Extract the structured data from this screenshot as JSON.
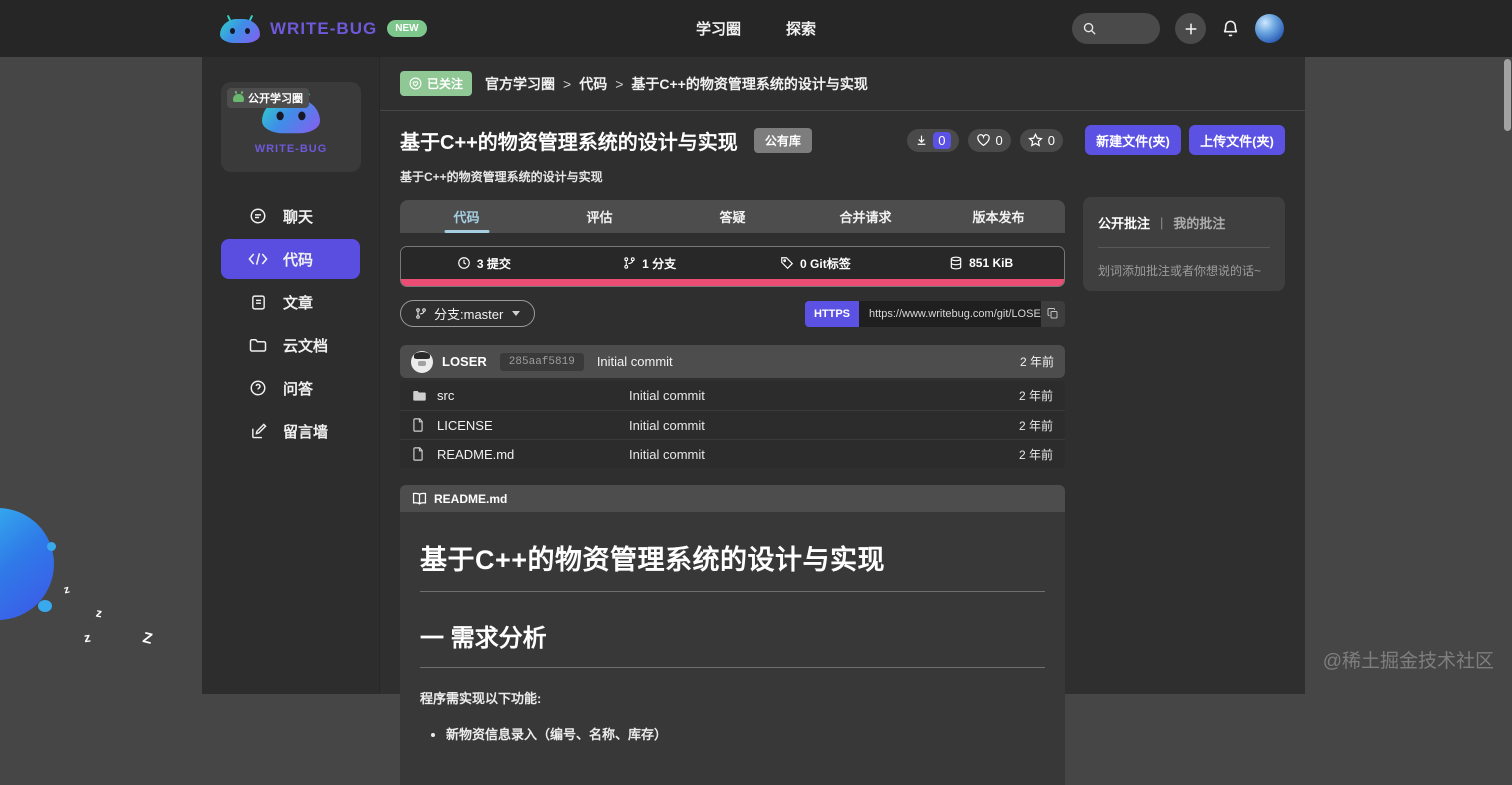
{
  "header": {
    "logo_text": "WRITE-BUG",
    "new_badge": "NEW",
    "nav": [
      {
        "label": "学习圈"
      },
      {
        "label": "探索"
      }
    ]
  },
  "sidebar": {
    "circle_badge": "公开学习圈",
    "circle_logo_text": "WRITE-BUG",
    "items": [
      {
        "label": "聊天",
        "icon": "chat",
        "active": false
      },
      {
        "label": "代码",
        "icon": "code",
        "active": true
      },
      {
        "label": "文章",
        "icon": "article",
        "active": false
      },
      {
        "label": "云文档",
        "icon": "cloud-doc",
        "active": false
      },
      {
        "label": "问答",
        "icon": "qa",
        "active": false
      },
      {
        "label": "留言墙",
        "icon": "message-wall",
        "active": false
      }
    ]
  },
  "breadcrumb": {
    "follow_label": "已关注",
    "items": [
      "官方学习圈",
      "代码",
      "基于C++的物资管理系统的设计与实现"
    ],
    "separator": ">"
  },
  "repo": {
    "title": "基于C++的物资管理系统的设计与实现",
    "visibility_badge": "公有库",
    "subtitle": "基于C++的物资管理系统的设计与实现",
    "downloads": "0",
    "likes": "0",
    "stars": "0",
    "new_file_button": "新建文件(夹)",
    "upload_file_button": "上传文件(夹)"
  },
  "tabs": [
    {
      "label": "代码",
      "active": true
    },
    {
      "label": "评估",
      "active": false
    },
    {
      "label": "答疑",
      "active": false
    },
    {
      "label": "合并请求",
      "active": false
    },
    {
      "label": "版本发布",
      "active": false
    }
  ],
  "stats": [
    {
      "icon": "clock",
      "label": "3 提交"
    },
    {
      "icon": "git-branch",
      "label": "1 分支"
    },
    {
      "icon": "tag",
      "label": "0 Git标签"
    },
    {
      "icon": "database",
      "label": "851 KiB"
    }
  ],
  "branch_bar": {
    "branch_label": "分支:master",
    "protocol": "HTTPS",
    "url": "https://www.writebug.com/git/LOSER"
  },
  "commit": {
    "author": "LOSER",
    "hash": "285aaf5819",
    "message": "Initial commit",
    "time": "2 年前"
  },
  "files": [
    {
      "name": "src",
      "type": "folder",
      "message": "Initial commit",
      "time": "2 年前"
    },
    {
      "name": "LICENSE",
      "type": "file",
      "message": "Initial commit",
      "time": "2 年前"
    },
    {
      "name": "README.md",
      "type": "file",
      "message": "Initial commit",
      "time": "2 年前"
    }
  ],
  "readme": {
    "filename": "README.md",
    "h1": "基于C++的物资管理系统的设计与实现",
    "h2": "一 需求分析",
    "paragraph": "程序需实现以下功能:",
    "bullets": [
      "新物资信息录入（编号、名称、库存）"
    ]
  },
  "annotations": {
    "tab_public": "公开批注",
    "tab_mine": "我的批注",
    "divider": "|",
    "placeholder": "划词添加批注或者你想说的话~"
  },
  "mascot": {
    "sleep_zs": [
      "z",
      "z",
      "z",
      "Z"
    ]
  },
  "watermark": "@稀土掘金技术社区",
  "colors": {
    "accent_purple": "#5b51e3",
    "badge_green": "#8fc795",
    "progress_pink": "#ec4d74",
    "active_tab_blue": "#a5cfe1",
    "brand_purple": "#6e59d9"
  }
}
